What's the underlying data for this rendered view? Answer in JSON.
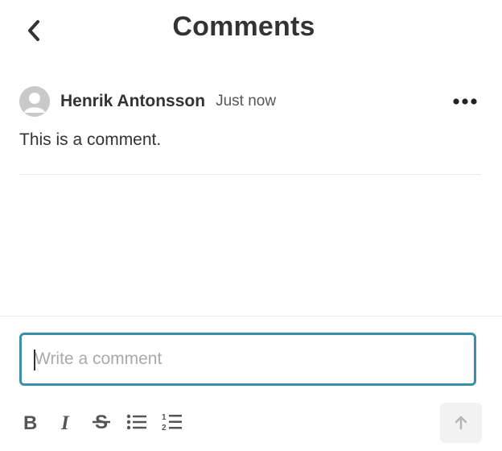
{
  "header": {
    "title": "Comments",
    "back_icon": "chevron-left-icon"
  },
  "comment": {
    "author": "Henrik Antonsson",
    "timestamp": "Just now",
    "body": "This is a comment.",
    "avatar_icon": "user-avatar-icon",
    "more_icon": "more-horizontal-icon"
  },
  "composer": {
    "value": "",
    "placeholder": "Write a comment",
    "toolbar": [
      {
        "icon": "bold-icon",
        "name": "bold"
      },
      {
        "icon": "italic-icon",
        "name": "italic"
      },
      {
        "icon": "strikethrough-icon",
        "name": "strikethrough"
      },
      {
        "icon": "bulleted-list-icon",
        "name": "bulleted-list"
      },
      {
        "icon": "numbered-list-icon",
        "name": "numbered-list"
      }
    ],
    "send_icon": "arrow-up-icon"
  },
  "colors": {
    "accent": "#3b8fa8",
    "text": "#333333",
    "muted": "#a9a9a9",
    "avatar": "#c9c9c9",
    "send_bg": "#f2f2f2",
    "send_icon": "#b5b5b5"
  }
}
